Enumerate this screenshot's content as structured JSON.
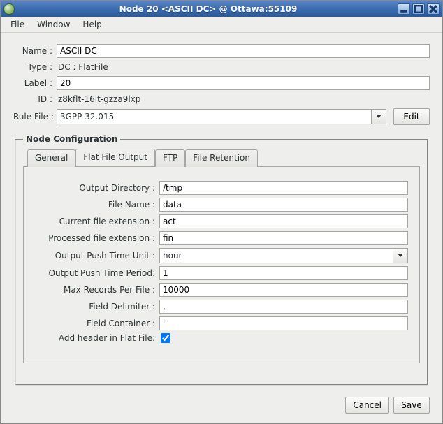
{
  "titlebar": {
    "title": "Node 20 <ASCII DC> @ Ottawa:55109"
  },
  "menu": {
    "file": "File",
    "window": "Window",
    "help": "Help"
  },
  "top": {
    "name_label": "Name :",
    "name_value": "ASCII DC",
    "type_label": "Type :",
    "type_value": "DC : FlatFile",
    "label_label": "Label :",
    "label_value": "20",
    "id_label": "ID :",
    "id_value": "z8kflt-16it-gzza9lxp",
    "rulefile_label": "Rule File :",
    "rulefile_value": "3GPP 32.015",
    "edit_label": "Edit"
  },
  "group": {
    "title": "Node Configuration"
  },
  "tabs": {
    "general": "General",
    "flatfile": "Flat File Output",
    "ftp": "FTP",
    "retention": "File Retention"
  },
  "cfg": {
    "outdir_label": "Output Directory :",
    "outdir_value": "/tmp",
    "fname_label": "File Name :",
    "fname_value": "data",
    "curext_label": "Current file extension :",
    "curext_value": "act",
    "procext_label": "Processed file extension :",
    "procext_value": "fin",
    "pushunit_label": "Output Push Time Unit :",
    "pushunit_value": "hour",
    "pushperiod_label": "Output Push Time Period:",
    "pushperiod_value": "1",
    "maxrec_label": "Max Records Per File :",
    "maxrec_value": "10000",
    "delim_label": "Field Delimiter :",
    "delim_value": ",",
    "container_label": "Field Container :",
    "container_value": "'",
    "addheader_label": "Add header in Flat File:"
  },
  "footer": {
    "cancel": "Cancel",
    "save": "Save"
  }
}
